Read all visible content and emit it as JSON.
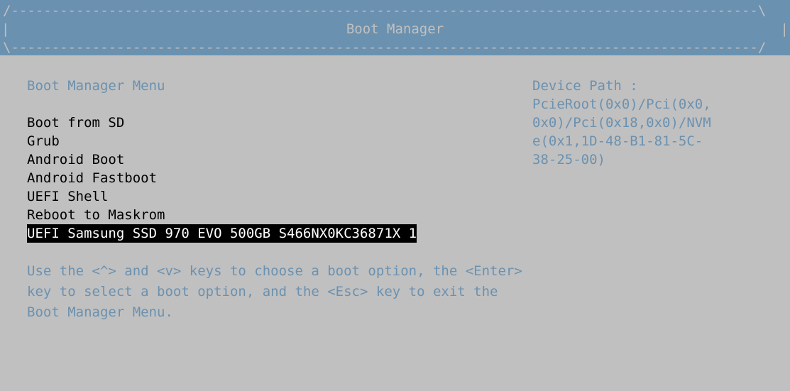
{
  "header": {
    "title": "Boot Manager",
    "top_border": "/--------------------------------------------------------------------------------------------\\",
    "bottom_border": "\\--------------------------------------------------------------------------------------------/",
    "pipe": "|"
  },
  "menu": {
    "title": "Boot Manager Menu",
    "items": [
      {
        "label": "Boot from SD",
        "selected": false
      },
      {
        "label": "Grub",
        "selected": false
      },
      {
        "label": "Android Boot",
        "selected": false
      },
      {
        "label": "Android Fastboot",
        "selected": false
      },
      {
        "label": "UEFI Shell",
        "selected": false
      },
      {
        "label": "Reboot to Maskrom",
        "selected": false
      },
      {
        "label": "UEFI Samsung SSD 970 EVO 500GB S466NX0KC36871X 1",
        "selected": true
      }
    ],
    "instructions": "Use the <^> and <v> keys to choose a boot option, the <Enter> key to select a boot option, and the <Esc> key to exit the Boot Manager Menu."
  },
  "device_info": {
    "label": "Device Path :",
    "path": "PcieRoot(0x0)/Pci(0x0,0x0)/Pci(0x18,0x0)/NVMe(0x1,1D-48-B1-81-5C-38-25-00)"
  }
}
